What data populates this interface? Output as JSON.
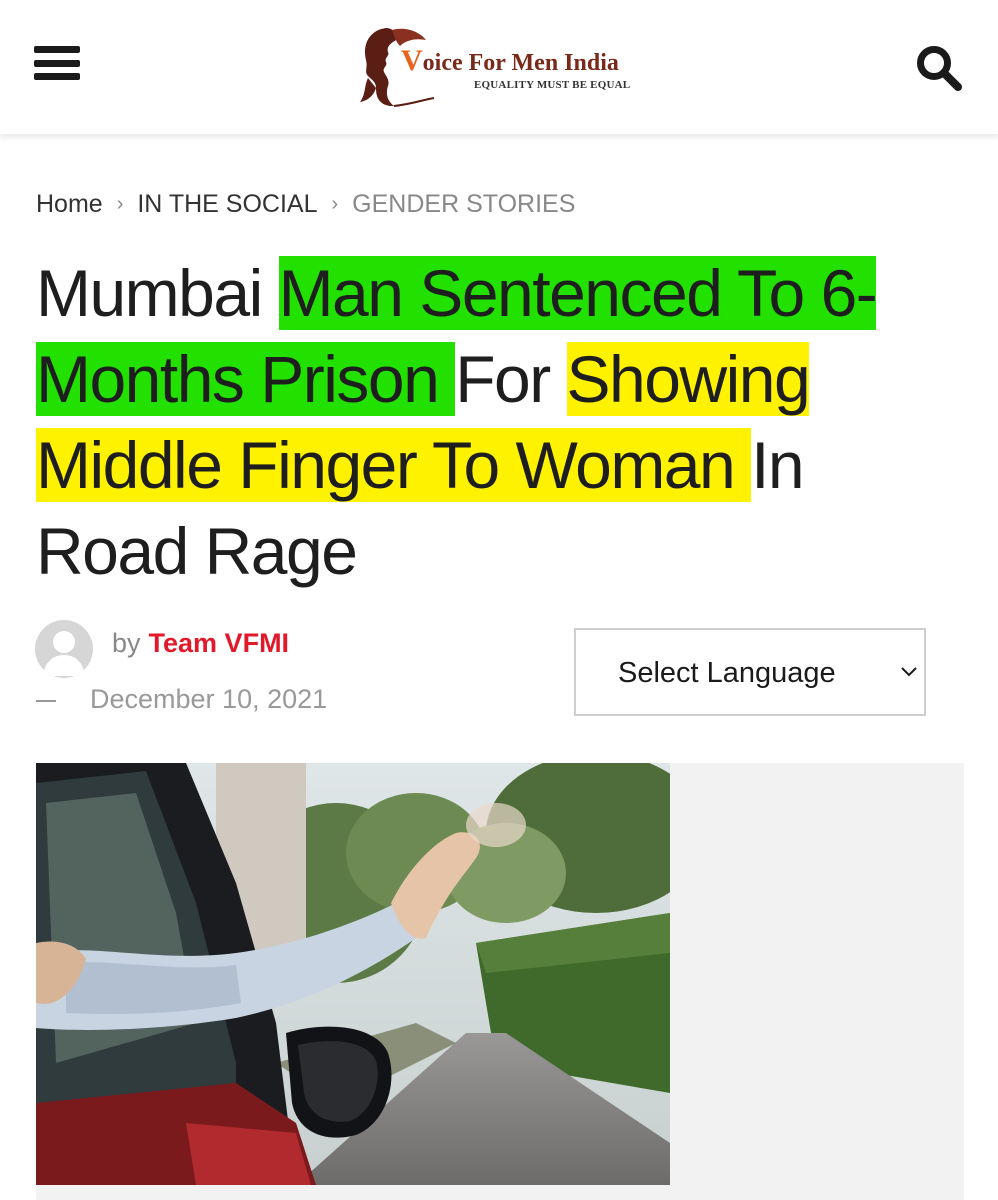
{
  "header": {
    "logo_title_initial": "V",
    "logo_title_rest": "oice For Men India",
    "logo_tagline": "EQUALITY MUST BE EQUAL",
    "menu_icon": "hamburger-icon",
    "search_icon": "search-icon"
  },
  "breadcrumb": {
    "items": [
      "Home",
      "IN THE SOCIAL",
      "GENDER STORIES"
    ],
    "separator": "›"
  },
  "article": {
    "title_parts": [
      {
        "text": "Mumbai ",
        "highlight": "none"
      },
      {
        "text": "Man Sentenced To 6-Months Prison ",
        "highlight": "green"
      },
      {
        "text": "For ",
        "highlight": "none"
      },
      {
        "text": "Showing Middle Finger To Woman ",
        "highlight": "yellow"
      },
      {
        "text": "In Road Rage",
        "highlight": "none"
      }
    ],
    "by_label": "by",
    "author": "Team VFMI",
    "date": "December 10, 2021"
  },
  "language_select": {
    "selected": "Select Language"
  },
  "colors": {
    "highlight_green": "#22e000",
    "highlight_yellow": "#fff200",
    "author_red": "#e11a2b",
    "logo_orange": "#e8641d",
    "logo_brown": "#7a2a1a"
  }
}
